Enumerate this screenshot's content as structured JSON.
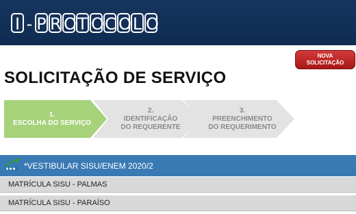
{
  "header": {
    "logo_chars": [
      "I",
      "-",
      "P",
      "R",
      "O",
      "T",
      "O",
      "C",
      "O",
      "L",
      "O"
    ]
  },
  "new_request": {
    "line1": "NOVA",
    "line2": "SOLICITAÇÃO"
  },
  "page_title": "SOLICITAÇÃO DE SERVIÇO",
  "steps": [
    {
      "number": "1.",
      "line1": "ESCOLHA DO SERVIÇO",
      "line2": "",
      "state": "active"
    },
    {
      "number": "2.",
      "line1": "IDENTIFICAÇÃO",
      "line2": "DO REQUERENTE",
      "state": "inactive"
    },
    {
      "number": "3.",
      "line1": "PREENCHIMENTO",
      "line2": "DO REQUERIMENTO",
      "state": "inactive"
    }
  ],
  "section": {
    "icon": "sisu-logo-icon",
    "title": "*VESTIBULAR SISU/ENEM 2020/2"
  },
  "services": [
    {
      "label": "MATRÍCULA SISU - PALMAS"
    },
    {
      "label": "MATRÍCULA SISU - PARAÍSO"
    }
  ],
  "colors": {
    "header_bg": "#16355e",
    "active_step": "#a6d27a",
    "inactive_step": "#e3e3e3",
    "section_bar": "#3a7ab4",
    "new_button": "#c22828"
  }
}
